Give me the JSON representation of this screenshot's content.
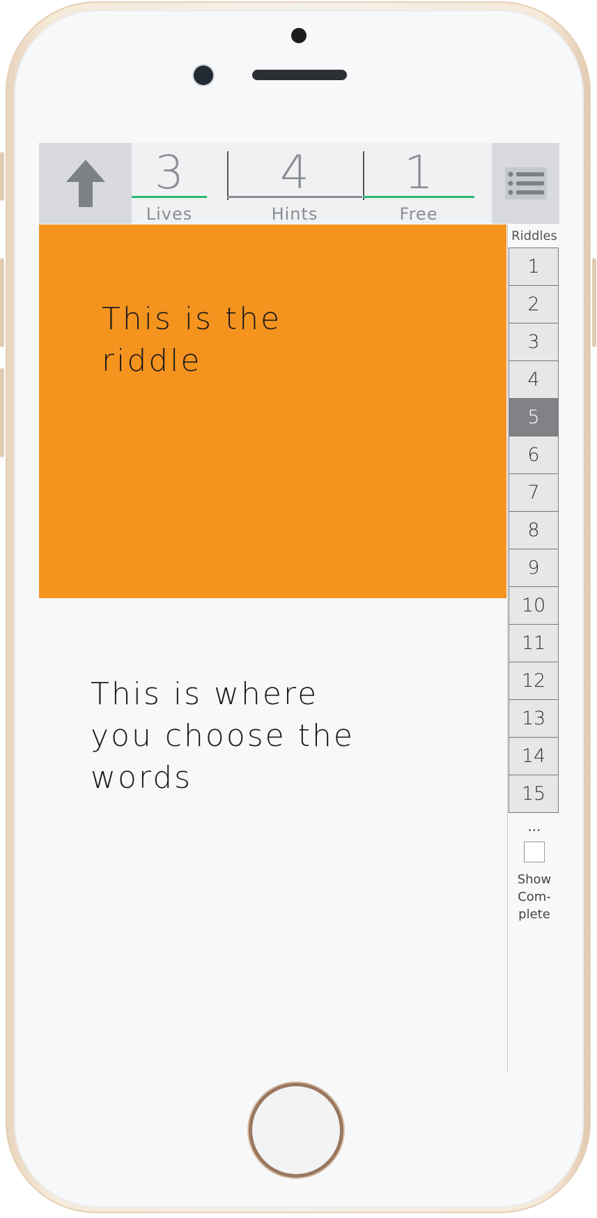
{
  "header": {
    "stats": [
      {
        "value": "3",
        "label": "Lives"
      },
      {
        "value": "4",
        "label": "Hints"
      },
      {
        "value": "1",
        "label": "Free"
      }
    ]
  },
  "riddle": {
    "text": "This is the riddle"
  },
  "words": {
    "text": "This is where you choose the words"
  },
  "sidebar": {
    "title": "Riddles",
    "items": [
      "1",
      "2",
      "3",
      "4",
      "5",
      "6",
      "7",
      "8",
      "9",
      "10",
      "11",
      "12",
      "13",
      "14",
      "15"
    ],
    "active_index": 4,
    "ellipsis": "...",
    "show_complete_label": "Show Com-plete",
    "show_complete_checked": false
  },
  "colors": {
    "riddle_panel": "#f5931f",
    "accent_line": "#2eb872",
    "active_riddle": "#808285"
  }
}
